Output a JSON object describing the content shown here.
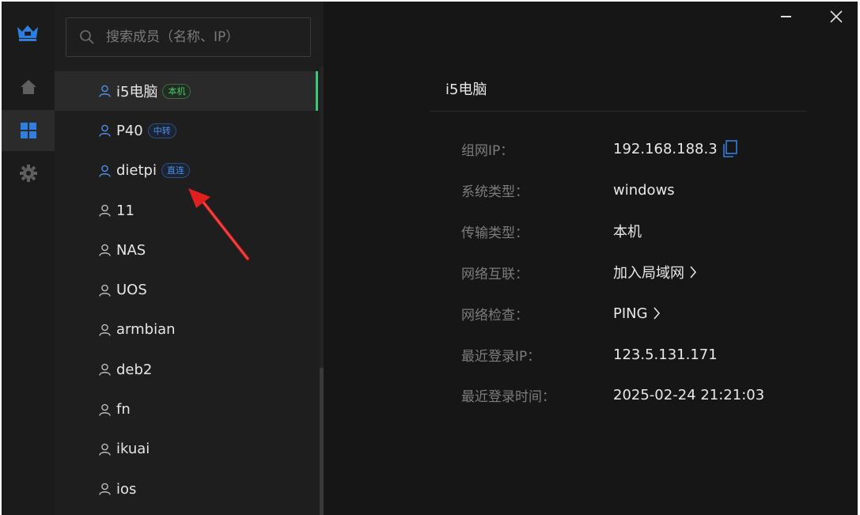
{
  "search": {
    "placeholder": "搜索成员（名称、IP）"
  },
  "rail": {
    "icons": [
      "crown-logo-icon",
      "home-icon",
      "grid-icon",
      "gear-icon"
    ]
  },
  "members": [
    {
      "name": "i5电脑",
      "tag": "本机",
      "tag_color": "green",
      "selected": true,
      "icon_color": "#4d8fe8"
    },
    {
      "name": "P40",
      "tag": "中转",
      "tag_color": "blue",
      "icon_color": "#4d8fe8"
    },
    {
      "name": "dietpi",
      "tag": "直连",
      "tag_color": "blue",
      "icon_color": "#4d8fe8"
    },
    {
      "name": "11"
    },
    {
      "name": "NAS"
    },
    {
      "name": "UOS"
    },
    {
      "name": "armbian"
    },
    {
      "name": "deb2"
    },
    {
      "name": "fn"
    },
    {
      "name": "ikuai"
    },
    {
      "name": "ios"
    }
  ],
  "detail": {
    "title": "i5电脑",
    "fields": [
      {
        "label": "组网IP：",
        "value": "192.168.188.3"
      },
      {
        "label": "系统类型：",
        "value": "windows"
      },
      {
        "label": "传输类型：",
        "value": "本机"
      },
      {
        "label": "网络互联：",
        "value": "加入局域网"
      },
      {
        "label": "网络检查：",
        "value": "PING"
      },
      {
        "label": "最近登录IP：",
        "value": "123.5.131.171"
      },
      {
        "label": "最近登录时间：",
        "value": "2025-02-24 21:21:03"
      }
    ]
  },
  "colors": {
    "accent_green": "#3ec77a",
    "accent_blue": "#4d8fe8",
    "annotation_red": "#e02020"
  }
}
